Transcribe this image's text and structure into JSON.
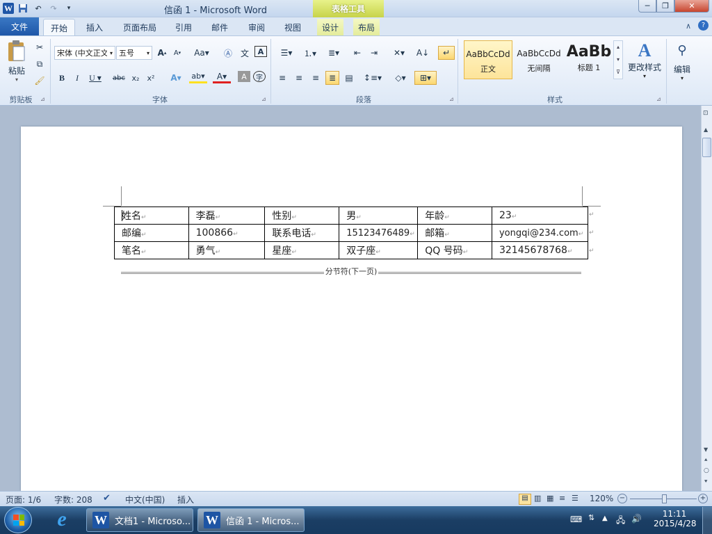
{
  "window": {
    "title": "信函 1 - Microsoft Word",
    "context_tab": "表格工具",
    "quick_access": [
      "W",
      "保存",
      "撤消",
      "重复",
      "自定义"
    ]
  },
  "tabs": [
    "文件",
    "开始",
    "插入",
    "页面布局",
    "引用",
    "邮件",
    "审阅",
    "视图",
    "设计",
    "布局"
  ],
  "ribbon": {
    "clipboard": {
      "label": "剪贴板",
      "paste": "粘贴"
    },
    "font": {
      "label": "字体",
      "font_name": "宋体 (中文正文)",
      "font_size": "五号"
    },
    "paragraph": {
      "label": "段落"
    },
    "styles": {
      "label": "样式",
      "items": [
        {
          "preview": "AaBbCcDd",
          "name": "正文"
        },
        {
          "preview": "AaBbCcDd",
          "name": "无间隔"
        },
        {
          "preview": "AaBb",
          "name": "标题 1"
        }
      ],
      "change_styles": "更改样式"
    },
    "editing": {
      "label": "编辑"
    }
  },
  "table": {
    "rows": [
      [
        "姓名",
        "李磊",
        "性别",
        "男",
        "年龄",
        "23"
      ],
      [
        "邮编",
        "100866",
        "联系电话",
        "15123476489",
        "邮箱",
        "yongqi@234.com"
      ],
      [
        "笔名",
        "勇气",
        "星座",
        "双子座",
        "QQ 号码",
        "32145678768"
      ]
    ]
  },
  "section_break": "分节符(下一页)",
  "status": {
    "page": "页面: 1/6",
    "words": "字数: 208",
    "language": "中文(中国)",
    "mode": "插入",
    "zoom": "120%"
  },
  "taskbar": {
    "items": [
      "文档1 - Microso...",
      "信函 1 - Micros..."
    ],
    "time": "11:11",
    "date": "2015/4/28"
  },
  "colors": {
    "accent": "#2b5797",
    "file_tab": "#1e57a8",
    "context_tab": "#c7d34a"
  }
}
